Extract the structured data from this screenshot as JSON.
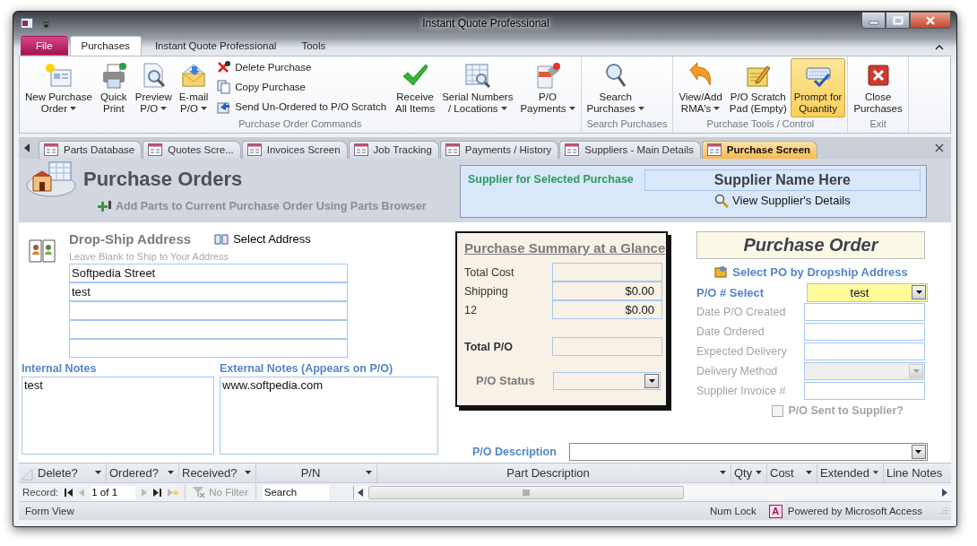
{
  "window": {
    "title": "Instant Quote Professional"
  },
  "ribbon": {
    "tabs": [
      {
        "label": "File",
        "kind": "file",
        "selected": false
      },
      {
        "label": "Purchases",
        "kind": "tab",
        "selected": true
      },
      {
        "label": "Instant Quote Professional",
        "kind": "tab",
        "selected": false
      },
      {
        "label": "Tools",
        "kind": "tab",
        "selected": false
      }
    ],
    "groups": [
      {
        "label": "Purchase Order Commands",
        "items": [
          {
            "kind": "large",
            "lines": [
              "New Purchase",
              "Order"
            ],
            "dropdown": true,
            "pressed": false
          },
          {
            "kind": "large",
            "lines": [
              "Quick",
              "Print"
            ],
            "dropdown": false,
            "pressed": false
          },
          {
            "kind": "large",
            "lines": [
              "Preview",
              "P/O"
            ],
            "dropdown": true,
            "pressed": false
          },
          {
            "kind": "large",
            "lines": [
              "E-mail",
              "P/O"
            ],
            "dropdown": true,
            "pressed": false
          },
          {
            "kind": "stack",
            "entries": [
              {
                "label": "Delete Purchase"
              },
              {
                "label": "Copy Purchase"
              },
              {
                "label": "Send Un-Ordered to P/O Scratch"
              }
            ]
          },
          {
            "kind": "large",
            "lines": [
              "Receive",
              "All Items"
            ],
            "dropdown": false,
            "pressed": false
          },
          {
            "kind": "large",
            "lines": [
              "Serial Numbers",
              "/ Locations"
            ],
            "dropdown": true,
            "pressed": false
          },
          {
            "kind": "large",
            "lines": [
              "P/O",
              "Payments"
            ],
            "dropdown": true,
            "pressed": false
          }
        ]
      },
      {
        "label": "Search Purchases",
        "items": [
          {
            "kind": "large",
            "lines": [
              "Search",
              "Purchases"
            ],
            "dropdown": true,
            "pressed": false
          }
        ]
      },
      {
        "label": "Purchase Tools / Control",
        "items": [
          {
            "kind": "large",
            "lines": [
              "View/Add",
              "RMA's"
            ],
            "dropdown": true,
            "pressed": false
          },
          {
            "kind": "large",
            "lines": [
              "P/O Scratch",
              "Pad (Empty)"
            ],
            "dropdown": false,
            "pressed": false
          },
          {
            "kind": "large",
            "lines": [
              "Prompt for",
              "Quantity"
            ],
            "dropdown": false,
            "pressed": true
          }
        ]
      },
      {
        "label": "Exit",
        "items": [
          {
            "kind": "large",
            "lines": [
              "Close",
              "Purchases"
            ],
            "dropdown": false,
            "pressed": false
          }
        ]
      }
    ]
  },
  "document_tabs": [
    {
      "label": "Parts Database",
      "selected": false
    },
    {
      "label": "Quotes Scre...",
      "selected": false
    },
    {
      "label": "Invoices Screen",
      "selected": false
    },
    {
      "label": "Job Tracking",
      "selected": false
    },
    {
      "label": "Payments / History",
      "selected": false
    },
    {
      "label": "Suppliers - Main Details",
      "selected": false
    },
    {
      "label": "Purchase Screen",
      "selected": true
    }
  ],
  "header": {
    "title": "Purchase Orders",
    "add_parts_link": "Add Parts to Current Purchase Order Using Parts Browser",
    "supplier": {
      "label": "Supplier for Selected Purchase",
      "name": "Supplier Name Here",
      "details_link": "View Supplier's Details"
    }
  },
  "dropship": {
    "title": "Drop-Ship Address",
    "select_button": "Select Address",
    "hint": "Leave Blank to Ship to Your Address",
    "lines": [
      {
        "value": "Softpedia Street"
      },
      {
        "value": "test"
      }
    ]
  },
  "notes": [
    {
      "label": "Internal Notes",
      "value": "test"
    },
    {
      "label": "External Notes (Appears on P/O)",
      "value": "www.softpedia.com"
    }
  ],
  "summary": {
    "title": "Purchase Summary at a Glance",
    "rows": [
      {
        "label": "Total Cost"
      },
      {
        "label": "Shipping",
        "value": "$0.00"
      },
      {
        "label": "12",
        "value": "$0.00"
      }
    ],
    "total_label": "Total P/O",
    "status_label": "P/O Status"
  },
  "purchase_order": {
    "title": "Purchase Order",
    "select_link": "Select PO by Dropship Address",
    "po_select": {
      "label": "P/O # Select",
      "value": "test"
    },
    "fields": [
      {
        "label": "Date P/O Created",
        "kind": "text",
        "disabled": true
      },
      {
        "label": "Date Ordered",
        "kind": "text",
        "disabled": true
      },
      {
        "label": "Expected Delivery",
        "kind": "text",
        "disabled": true
      },
      {
        "label": "Delivery Method",
        "kind": "combo",
        "disabled": true
      },
      {
        "label": "Supplier Invoice #",
        "kind": "text",
        "disabled": true
      }
    ],
    "sent_checkbox": {
      "label": "P/O Sent to Supplier?",
      "checked": false,
      "disabled": true
    }
  },
  "description": {
    "label": "P/O Description"
  },
  "datasheet": {
    "columns": [
      {
        "label": "Delete?"
      },
      {
        "label": "Ordered?"
      },
      {
        "label": "Received?"
      },
      {
        "label": "P/N"
      },
      {
        "label": "Part Description"
      },
      {
        "label": "Qty"
      },
      {
        "label": "Cost"
      },
      {
        "label": "Extended"
      },
      {
        "label": "Line Notes"
      }
    ]
  },
  "navigation": {
    "record_label": "Record:",
    "position": "1 of 1",
    "filter": "No Filter",
    "search_placeholder": "Search"
  },
  "status_bar": {
    "view": "Form View",
    "num_lock": "Num Lock",
    "app_icon_letter": "A",
    "powered_by": "Powered by Microsoft Access"
  }
}
